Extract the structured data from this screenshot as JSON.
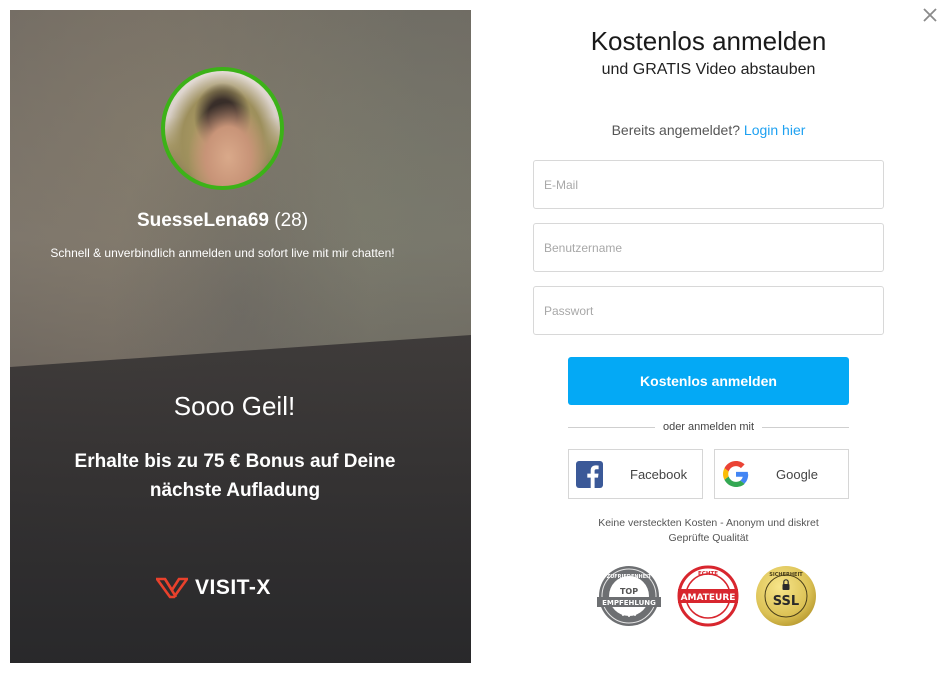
{
  "close": {
    "icon": "close-icon",
    "label": "×"
  },
  "promo": {
    "model_name": "SuesseLena69",
    "model_age": "(28)",
    "tagline": "Schnell & unverbindlich anmelden und sofort live mit mir chatten!",
    "headline": "Sooo Geil!",
    "bonus_text": "Erhalte bis zu 75 € Bonus auf Deine nächste Aufladung",
    "brand": "VISIT-X",
    "avatar_ring_color": "#3cb218",
    "brand_color": "#e8412c"
  },
  "form": {
    "title": "Kostenlos anmelden",
    "subtitle": "und GRATIS Video abstauben",
    "already_registered": "Bereits angemeldet?",
    "login_link": "Login hier",
    "fields": {
      "email": {
        "placeholder": "E-Mail",
        "value": ""
      },
      "username": {
        "placeholder": "Benutzername",
        "value": ""
      },
      "password": {
        "placeholder": "Passwort",
        "value": ""
      }
    },
    "submit_label": "Kostenlos anmelden",
    "submit_color": "#04a9f5",
    "divider_text": "oder anmelden mit",
    "social": {
      "facebook": {
        "label": "Facebook",
        "icon": "facebook-icon"
      },
      "google": {
        "label": "Google",
        "icon": "google-icon"
      }
    },
    "trust_line1": "Keine versteckten Kosten - Anonym und diskret",
    "trust_line2": "Geprüfte Qualität",
    "seals": {
      "top": {
        "ring_text": "ZUFRIEDENHEIT",
        "main": "TOP",
        "banner": "EMPFEHLUNG"
      },
      "amateur": {
        "ring_text": "ECHTE",
        "banner": "AMATEURE"
      },
      "ssl": {
        "ring_text": "SICHERHEIT",
        "main": "SSL"
      }
    }
  }
}
